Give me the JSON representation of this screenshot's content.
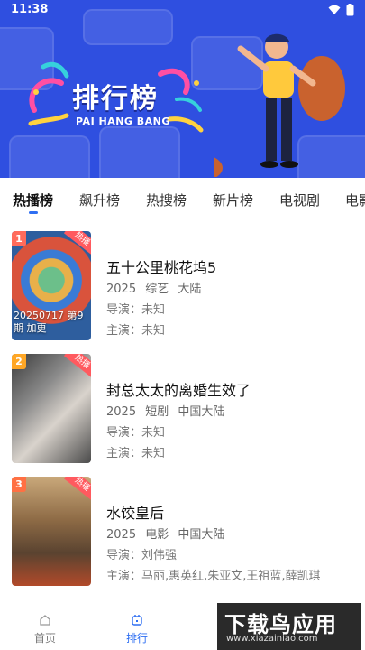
{
  "status": {
    "time": "11:38"
  },
  "banner": {
    "title": "排行榜",
    "subtitle": "PAI HANG BANG"
  },
  "tabs": [
    "热播榜",
    "飙升榜",
    "热搜榜",
    "新片榜",
    "电视剧",
    "电影"
  ],
  "active_tab": 0,
  "items": [
    {
      "rank": "1",
      "badge": "热播",
      "poster_caption": "20250717 第9期 加更",
      "title": "五十公里桃花坞5",
      "year": "2025",
      "genre": "综艺",
      "region": "大陆",
      "director_label": "导演：",
      "director": "未知",
      "cast_label": "主演：",
      "cast": "未知"
    },
    {
      "rank": "2",
      "badge": "热播",
      "poster_caption": "",
      "title": "封总太太的离婚生效了",
      "year": "2025",
      "genre": "短剧",
      "region": "中国大陆",
      "director_label": "导演：",
      "director": "未知",
      "cast_label": "主演：",
      "cast": "未知"
    },
    {
      "rank": "3",
      "badge": "热播",
      "poster_caption": "",
      "title": "水饺皇后",
      "year": "2025",
      "genre": "电影",
      "region": "中国大陆",
      "director_label": "导演：",
      "director": "刘伟强",
      "cast_label": "主演：",
      "cast": "马丽,惠英红,朱亚文,王祖蓝,薛凯琪"
    }
  ],
  "bottom_nav": [
    {
      "label": "首页",
      "icon": "home-icon"
    },
    {
      "label": "排行",
      "icon": "ranking-icon"
    }
  ],
  "watermark": {
    "main": "下载鸟应用",
    "url": "www.xiazainiao.com"
  },
  "colors": {
    "banner_bg": "#2f4fe0",
    "accent": "#2f6ff2",
    "rank1": "#ff6b5b",
    "rank2": "#ffa726",
    "rank3": "#ff7043",
    "hot_badge": "#ff5a5f"
  }
}
